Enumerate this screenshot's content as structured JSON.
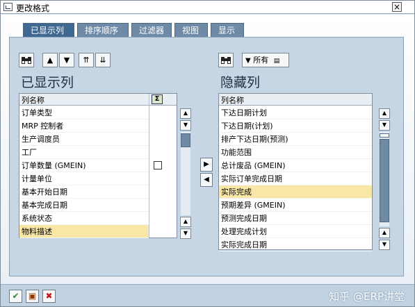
{
  "window": {
    "title": "更改格式",
    "close_glyph": "×"
  },
  "tabs": [
    {
      "label": "已显示列",
      "active": true
    },
    {
      "label": "排序顺序",
      "active": false
    },
    {
      "label": "过滤器",
      "active": false
    },
    {
      "label": "视图",
      "active": false
    },
    {
      "label": "显示",
      "active": false
    }
  ],
  "left_pane": {
    "heading": "已显示列",
    "toolbar": {
      "find_icon": "binoculars-icon",
      "btn_up": "▲",
      "btn_down": "▼",
      "btn_top": "⇈",
      "btn_bottom": "⇊"
    },
    "column_header": "列名称",
    "sum_icon": "Σ",
    "rows": [
      "订单类型",
      "MRP 控制者",
      "生产调度员",
      "工厂",
      "订单数量 (GMEIN)",
      "计量单位",
      "基本开始日期",
      "基本完成日期",
      "系统状态",
      "物料描述"
    ],
    "selected_row": 9
  },
  "move": {
    "right_glyph": "▶",
    "left_glyph": "◀"
  },
  "right_pane": {
    "heading": "隐藏列",
    "toolbar": {
      "filter_label": "所有",
      "filter_icon": "filter-icon"
    },
    "column_header": "列名称",
    "rows": [
      "下达日期计划",
      "下达日期(计划)",
      "排产下达日期(预测)",
      "功能范围",
      "总计废品 (GMEIN)",
      "实际订单完成日期",
      "实际完成",
      "预期差异 (GMEIN)",
      "预测完成日期",
      "处理完成计划",
      "实际完成日期"
    ],
    "selected_row": 6
  },
  "bottom": {
    "confirm_glyph": "✔",
    "save_glyph": "▣",
    "cancel_glyph": "✖",
    "watermark": "知乎 @ERP讲堂"
  },
  "colors": {
    "tab_active": "#3f6993",
    "selection": "#f8e7a7",
    "panel": "#c6d6e4"
  }
}
